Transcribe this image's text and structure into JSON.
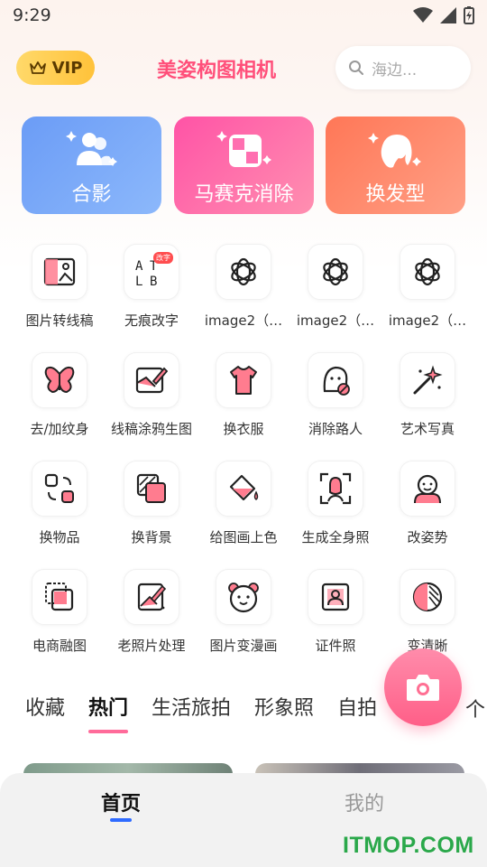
{
  "status_bar": {
    "time": "9:29",
    "icons": [
      "wifi-icon",
      "signal-icon",
      "battery-charging-icon"
    ]
  },
  "header": {
    "vip_label": "VIP",
    "app_title": "美姿构图相机",
    "search_placeholder": "海边..."
  },
  "feature_cards": [
    {
      "label": "合影",
      "icon": "group-photo-icon"
    },
    {
      "label": "马赛克消除",
      "icon": "mosaic-icon"
    },
    {
      "label": "换发型",
      "icon": "hairstyle-icon"
    }
  ],
  "tools": [
    {
      "label": "图片转线稿",
      "icon": "line-art-icon"
    },
    {
      "label": "无痕改字",
      "icon": "text-edit-icon",
      "badge": "改字"
    },
    {
      "label": "image2（…",
      "icon": "ai-knot-icon"
    },
    {
      "label": "image2（…",
      "icon": "ai-knot-icon"
    },
    {
      "label": "image2（…",
      "icon": "ai-knot-icon"
    },
    {
      "label": "去/加纹身",
      "icon": "butterfly-icon"
    },
    {
      "label": "线稿涂鸦生图",
      "icon": "doodle-icon"
    },
    {
      "label": "换衣服",
      "icon": "shirt-icon"
    },
    {
      "label": "消除路人",
      "icon": "remove-person-icon"
    },
    {
      "label": "艺术写真",
      "icon": "magic-wand-icon"
    },
    {
      "label": "换物品",
      "icon": "swap-object-icon"
    },
    {
      "label": "换背景",
      "icon": "background-icon"
    },
    {
      "label": "给图画上色",
      "icon": "paint-bucket-icon"
    },
    {
      "label": "生成全身照",
      "icon": "full-body-icon"
    },
    {
      "label": "改姿势",
      "icon": "pose-icon"
    },
    {
      "label": "电商融图",
      "icon": "merge-icon"
    },
    {
      "label": "老照片处理",
      "icon": "old-photo-icon"
    },
    {
      "label": "图片变漫画",
      "icon": "bear-icon"
    },
    {
      "label": "证件照",
      "icon": "id-photo-icon"
    },
    {
      "label": "变清晰",
      "icon": "sharpen-icon"
    }
  ],
  "category_tabs": [
    {
      "label": "收藏",
      "active": false
    },
    {
      "label": "热门",
      "active": true
    },
    {
      "label": "生活旅拍",
      "active": false
    },
    {
      "label": "形象照",
      "active": false
    },
    {
      "label": "自拍",
      "active": false
    }
  ],
  "category_more": "个",
  "bottom_nav": {
    "home": "首页",
    "mine": "我的"
  },
  "watermark": "ITMOP.COM",
  "colors": {
    "accent_pink": "#ff6b9a",
    "title_pink": "#ff4f7a",
    "vip_gold": "#ffc23a",
    "nav_indicator": "#2f6bff"
  }
}
